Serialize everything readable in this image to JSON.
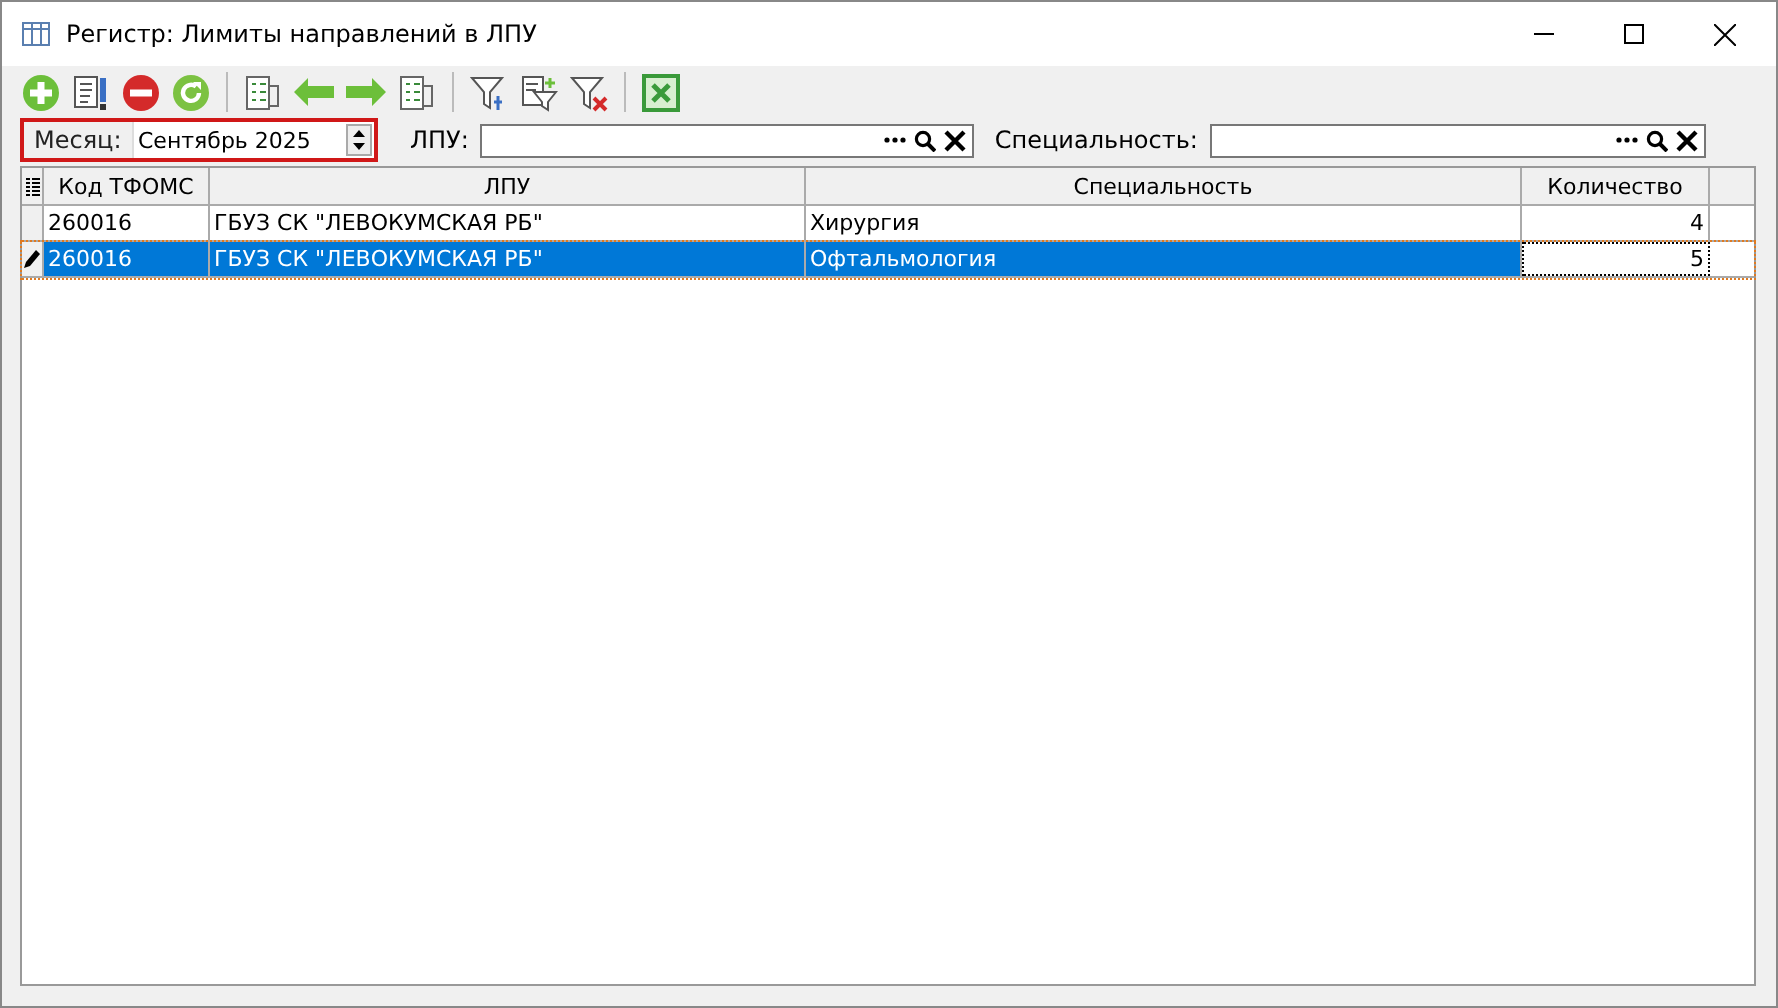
{
  "window": {
    "title": "Регистр: Лимиты направлений в ЛПУ"
  },
  "filters": {
    "month": {
      "label": "Месяц:",
      "value": "Сентябрь 2025"
    },
    "lpu": {
      "label": "ЛПУ:"
    },
    "specialty": {
      "label": "Специальность:"
    }
  },
  "table": {
    "columns": [
      "Код ТФОМС",
      "ЛПУ",
      "Специальность",
      "Количество"
    ],
    "rows": [
      {
        "cells": [
          "260016",
          "ГБУЗ СК \"ЛЕВОКУМСКАЯ РБ\"",
          "Хирургия",
          "4"
        ],
        "selected": false
      },
      {
        "cells": [
          "260016",
          "ГБУЗ СК \"ЛЕВОКУМСКАЯ РБ\"",
          "Офтальмология",
          "5"
        ],
        "selected": true
      }
    ]
  }
}
